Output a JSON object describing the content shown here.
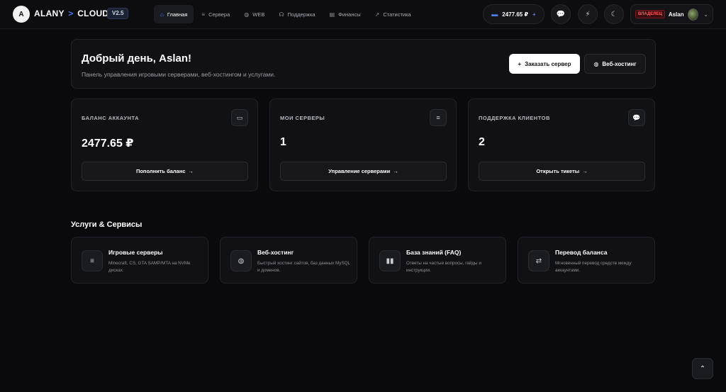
{
  "header": {
    "logo_text": "A",
    "brand_left": "ALANY",
    "brand_sep": ">",
    "brand_right": "CLOUD",
    "version": "V2.5",
    "nav": [
      {
        "label": "Главная",
        "icon": "⌂"
      },
      {
        "label": "Сервера",
        "icon": "≡"
      },
      {
        "label": "WEB",
        "icon": "◍"
      },
      {
        "label": "Поддержка",
        "icon": "☊"
      },
      {
        "label": "Финансы",
        "icon": "▤"
      },
      {
        "label": "Статистика",
        "icon": "↗"
      }
    ],
    "balance": "2477.65 ₽",
    "balance_plus": "+",
    "role_badge": "ВЛАДЕЛЕЦ",
    "username": "Aslan"
  },
  "welcome": {
    "title": "Добрый день, Aslan!",
    "subtitle": "Панель управления игровыми серверами, веб-хостингом и услугами.",
    "order_button": "Заказать сервер",
    "hosting_button": "Веб-хостинг"
  },
  "stats": [
    {
      "label": "БАЛАНС АККАУНТА",
      "value": "2477.65 ₽",
      "button": "Пополнить баланс",
      "icon": "wallet-icon"
    },
    {
      "label": "МОИ СЕРВЕРЫ",
      "value": "1",
      "button": "Управление серверами",
      "icon": "server-icon"
    },
    {
      "label": "ПОДДЕРЖКА КЛИЕНТОВ",
      "value": "2",
      "button": "Открыть тикеты",
      "icon": "chat-icon"
    }
  ],
  "services_title": "Услуги & Сервисы",
  "services": [
    {
      "title": "Игровые серверы",
      "desc": "Minecraft, CS, GTA SAMP/MTA на NVMe дисках.",
      "icon": "server-icon"
    },
    {
      "title": "Веб-хостинг",
      "desc": "Быстрый хостинг сайтов, баз данных MySQL и доменов.",
      "icon": "globe-icon"
    },
    {
      "title": "База знаний (FAQ)",
      "desc": "Ответы на частые вопросы, гайды и инструкции.",
      "icon": "book-icon"
    },
    {
      "title": "Перевод баланса",
      "desc": "Мгновенный перевод средств между аккаунтами.",
      "icon": "transfer-icon"
    }
  ],
  "colors": {
    "accent": "#4c82ff",
    "owner_red": "#ff5a5f",
    "background": "#0a0a0c",
    "panel": "#111115"
  }
}
